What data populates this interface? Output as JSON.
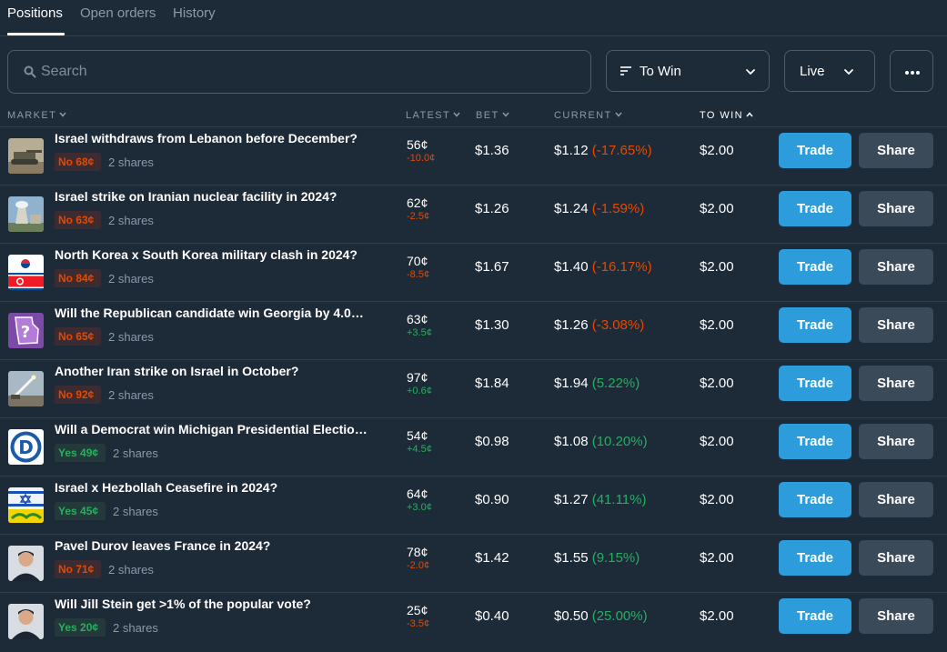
{
  "tabs": [
    {
      "label": "Positions",
      "active": true
    },
    {
      "label": "Open orders",
      "active": false
    },
    {
      "label": "History",
      "active": false
    }
  ],
  "search": {
    "placeholder": "Search",
    "value": "",
    "icon": "search-icon"
  },
  "sort_dropdown": {
    "label": "To Win",
    "icon": "sort-icon"
  },
  "status_dropdown": {
    "label": "Live"
  },
  "more_button": {
    "icon": "more-horizontal-icon"
  },
  "columns": [
    {
      "label": "MARKET",
      "active": false,
      "direction": "down"
    },
    {
      "label": "LATEST",
      "active": false,
      "direction": "down"
    },
    {
      "label": "BET",
      "active": false,
      "direction": "down"
    },
    {
      "label": "CURRENT",
      "active": false,
      "direction": "down"
    },
    {
      "label": "TO WIN",
      "active": true,
      "direction": "up"
    }
  ],
  "colors": {
    "background": "#1d2b39",
    "trade_button": "#2d9cdb",
    "share_button": "#3b4a59",
    "negative": "#e64800",
    "positive": "#27ae60",
    "muted_text": "#8a9aaa"
  },
  "rows": [
    {
      "question": "Israel withdraws from Lebanon before December?",
      "badge": "No 68¢",
      "side": "no",
      "shares": "2 shares",
      "latest": "56¢",
      "delta": "-10.0¢",
      "delta_sign": "neg",
      "bet": "$1.36",
      "current": "$1.12",
      "pct": "(-17.65%)",
      "pct_sign": "neg",
      "to_win": "$2.00",
      "trade": "Trade",
      "share": "Share",
      "thumb": "tank-thumbnail"
    },
    {
      "question": "Israel strike on Iranian nuclear facility in 2024?",
      "badge": "No 63¢",
      "side": "no",
      "shares": "2 shares",
      "latest": "62¢",
      "delta": "-2.5¢",
      "delta_sign": "neg",
      "bet": "$1.26",
      "current": "$1.24",
      "pct": "(-1.59%)",
      "pct_sign": "neg",
      "to_win": "$2.00",
      "trade": "Trade",
      "share": "Share",
      "thumb": "nuclear-plant-thumbnail"
    },
    {
      "question": "North Korea x South Korea military clash in 2024?",
      "badge": "No 84¢",
      "side": "no",
      "shares": "2 shares",
      "latest": "70¢",
      "delta": "-8.5¢",
      "delta_sign": "neg",
      "bet": "$1.67",
      "current": "$1.40",
      "pct": "(-16.17%)",
      "pct_sign": "neg",
      "to_win": "$2.00",
      "trade": "Trade",
      "share": "Share",
      "thumb": "korea-flags-thumbnail"
    },
    {
      "question": "Will the Republican candidate win Georgia by 4.0…",
      "badge": "No 65¢",
      "side": "no",
      "shares": "2 shares",
      "latest": "63¢",
      "delta": "+3.5¢",
      "delta_sign": "pos",
      "bet": "$1.30",
      "current": "$1.26",
      "pct": "(-3.08%)",
      "pct_sign": "neg",
      "to_win": "$2.00",
      "trade": "Trade",
      "share": "Share",
      "thumb": "georgia-map-thumbnail"
    },
    {
      "question": "Another Iran strike on Israel in October?",
      "badge": "No 92¢",
      "side": "no",
      "shares": "2 shares",
      "latest": "97¢",
      "delta": "+0.6¢",
      "delta_sign": "pos",
      "bet": "$1.84",
      "current": "$1.94",
      "pct": "(5.22%)",
      "pct_sign": "pos",
      "to_win": "$2.00",
      "trade": "Trade",
      "share": "Share",
      "thumb": "missile-thumbnail"
    },
    {
      "question": "Will a Democrat win Michigan Presidential Electio…",
      "badge": "Yes 49¢",
      "side": "yes",
      "shares": "2 shares",
      "latest": "54¢",
      "delta": "+4.5¢",
      "delta_sign": "pos",
      "bet": "$0.98",
      "current": "$1.08",
      "pct": "(10.20%)",
      "pct_sign": "pos",
      "to_win": "$2.00",
      "trade": "Trade",
      "share": "Share",
      "thumb": "democrat-logo-thumbnail"
    },
    {
      "question": "Israel x Hezbollah Ceasefire in 2024?",
      "badge": "Yes 45¢",
      "side": "yes",
      "shares": "2 shares",
      "latest": "64¢",
      "delta": "+3.0¢",
      "delta_sign": "pos",
      "bet": "$0.90",
      "current": "$1.27",
      "pct": "(41.11%)",
      "pct_sign": "pos",
      "to_win": "$2.00",
      "trade": "Trade",
      "share": "Share",
      "thumb": "flags-thumbnail"
    },
    {
      "question": "Pavel Durov leaves France in 2024?",
      "badge": "No 71¢",
      "side": "no",
      "shares": "2 shares",
      "latest": "78¢",
      "delta": "-2.0¢",
      "delta_sign": "neg",
      "bet": "$1.42",
      "current": "$1.55",
      "pct": "(9.15%)",
      "pct_sign": "pos",
      "to_win": "$2.00",
      "trade": "Trade",
      "share": "Share",
      "thumb": "portrait-thumbnail"
    },
    {
      "question": "Will Jill Stein get >1% of the popular vote?",
      "badge": "Yes 20¢",
      "side": "yes",
      "shares": "2 shares",
      "latest": "25¢",
      "delta": "-3.5¢",
      "delta_sign": "neg",
      "bet": "$0.40",
      "current": "$0.50",
      "pct": "(25.00%)",
      "pct_sign": "pos",
      "to_win": "$2.00",
      "trade": "Trade",
      "share": "Share",
      "thumb": "portrait-thumbnail"
    }
  ]
}
